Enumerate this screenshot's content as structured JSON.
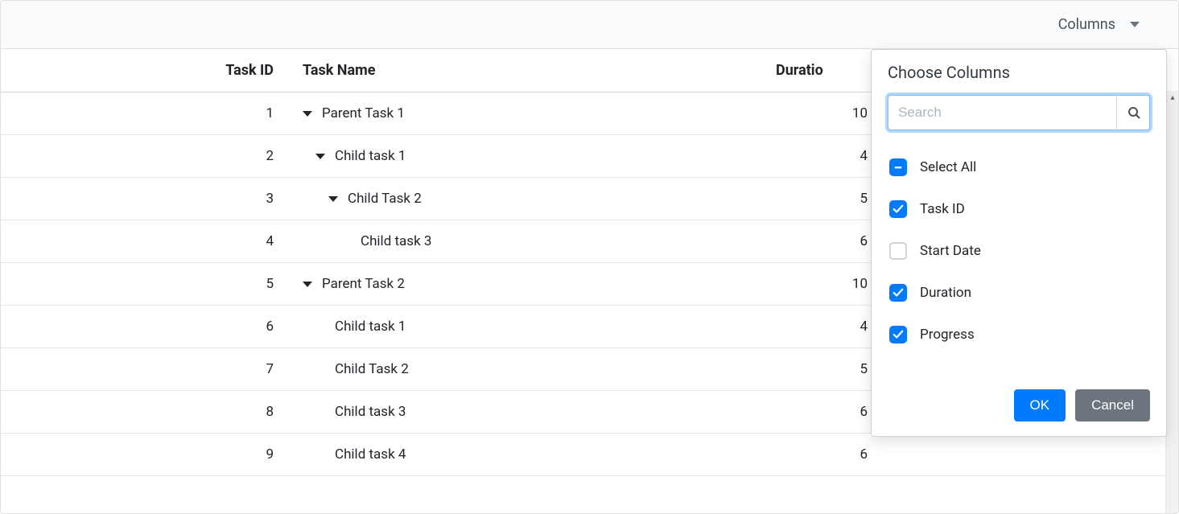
{
  "toolbar": {
    "columns_label": "Columns"
  },
  "headers": {
    "task_id": "Task ID",
    "task_name": "Task Name",
    "duration": "Duratio",
    "progress": ""
  },
  "rows": [
    {
      "id": "1",
      "name": "Parent Task 1",
      "duration": "10",
      "indent": 0,
      "expand": true
    },
    {
      "id": "2",
      "name": "Child task 1",
      "duration": "4",
      "indent": 1,
      "expand": true
    },
    {
      "id": "3",
      "name": "Child Task 2",
      "duration": "5",
      "indent": 2,
      "expand": true
    },
    {
      "id": "4",
      "name": "Child task 3",
      "duration": "6",
      "indent": 3,
      "expand": false
    },
    {
      "id": "5",
      "name": "Parent Task 2",
      "duration": "10",
      "indent": 0,
      "expand": true
    },
    {
      "id": "6",
      "name": "Child task 1",
      "duration": "4",
      "indent": 1,
      "expand": false
    },
    {
      "id": "7",
      "name": "Child Task 2",
      "duration": "5",
      "indent": 1,
      "expand": false
    },
    {
      "id": "8",
      "name": "Child task 3",
      "duration": "6",
      "indent": 1,
      "expand": false
    },
    {
      "id": "9",
      "name": "Child task 4",
      "duration": "6",
      "indent": 1,
      "expand": false
    }
  ],
  "dialog": {
    "title": "Choose Columns",
    "search_placeholder": "Search",
    "ok_label": "OK",
    "cancel_label": "Cancel",
    "items": [
      {
        "label": "Select All",
        "state": "indeterminate"
      },
      {
        "label": "Task ID",
        "state": "checked"
      },
      {
        "label": "Start Date",
        "state": "unchecked"
      },
      {
        "label": "Duration",
        "state": "checked"
      },
      {
        "label": "Progress",
        "state": "checked"
      }
    ]
  }
}
